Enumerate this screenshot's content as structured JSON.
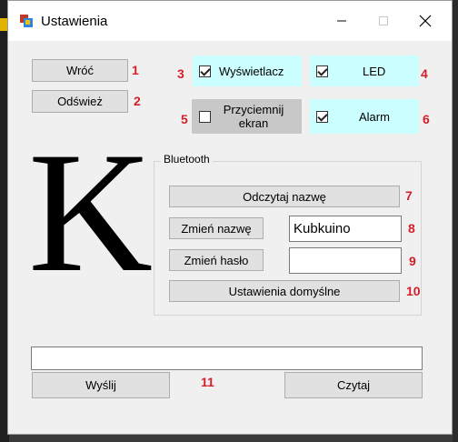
{
  "window": {
    "title": "Ustawienia"
  },
  "titlebar": {
    "minimize_icon": "minimize-icon",
    "maximize_icon": "maximize-icon",
    "close_icon": "close-icon"
  },
  "nav": {
    "back_label": "Wróć",
    "refresh_label": "Odśwież"
  },
  "display": {
    "display_label": "Wyświetlacz",
    "display_checked": true,
    "led_label": "LED",
    "led_checked": true,
    "dim_label": "Przyciemnij ekran",
    "dim_checked": false,
    "alarm_label": "Alarm",
    "alarm_checked": true
  },
  "logo": {
    "letter": "K"
  },
  "bluetooth": {
    "group_label": "Bluetooth",
    "read_name_label": "Odczytaj nazwę",
    "change_name_label": "Zmień nazwę",
    "name_value": "Kubkuino",
    "change_password_label": "Zmień hasło",
    "password_value": "",
    "defaults_label": "Ustawienia domyślne"
  },
  "bottom": {
    "input_value": "",
    "send_label": "Wyślij",
    "read_label": "Czytaj"
  },
  "annotations": {
    "n1": "1",
    "n2": "2",
    "n3": "3",
    "n4": "4",
    "n5": "5",
    "n6": "6",
    "n7": "7",
    "n8": "8",
    "n9": "9",
    "n10": "10",
    "n11": "11"
  },
  "colors": {
    "highlight": "#ccffff",
    "dim_panel": "#c8c8c8",
    "annotation": "#d21f2a"
  }
}
